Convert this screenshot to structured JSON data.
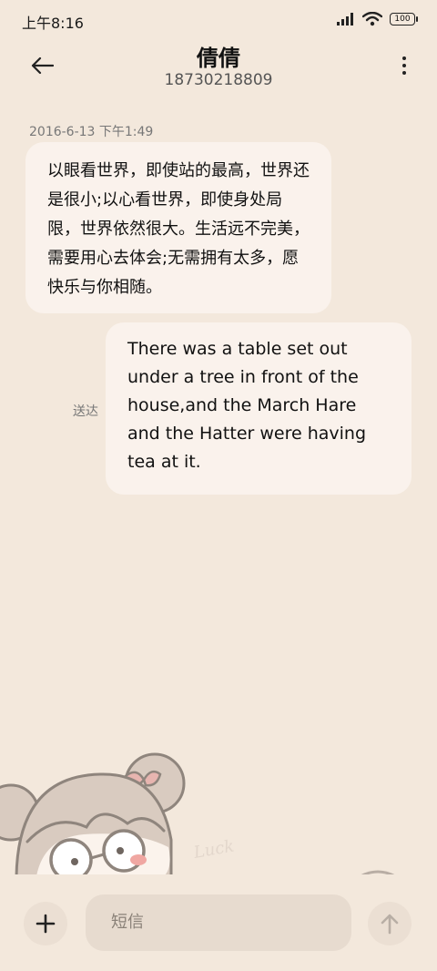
{
  "status_bar": {
    "time": "上午8:16",
    "battery": "100"
  },
  "header": {
    "contact_name": "倩倩",
    "phone_number": "18730218809"
  },
  "messages": [
    {
      "direction": "incoming",
      "timestamp": "2016-6-13 下午1:49",
      "text": "以眼看世界，即使站的最高，世界还是很小;以心看世界，即使身处局限，世界依然很大。生活远不完美，需要用心去体会;无需拥有太多，愿快乐与你相随。"
    },
    {
      "direction": "outgoing",
      "status": "送达",
      "text": "There was a table set out under a tree in front of the house,and the March Hare and the Hatter were having tea at it."
    }
  ],
  "sticker": {
    "text": "Luck"
  },
  "composer": {
    "placeholder": "短信"
  },
  "icons": {
    "back": "back-arrow-icon",
    "more": "more-vertical-icon",
    "add": "plus-icon",
    "send": "send-arrow-up-icon"
  }
}
